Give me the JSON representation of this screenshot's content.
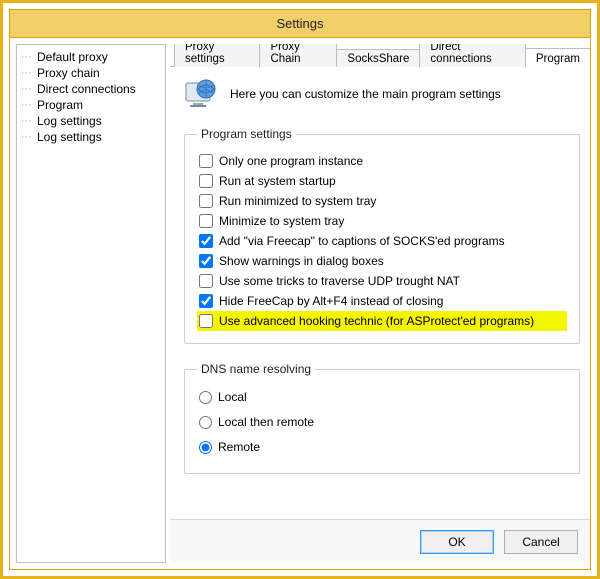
{
  "window": {
    "title": "Settings"
  },
  "tree": {
    "items": [
      {
        "label": "Default proxy"
      },
      {
        "label": "Proxy chain"
      },
      {
        "label": "Direct connections"
      },
      {
        "label": "Program"
      },
      {
        "label": "Log settings"
      },
      {
        "label": "Log settings"
      }
    ]
  },
  "tabs": [
    {
      "label": "Proxy settings"
    },
    {
      "label": "Proxy Chain"
    },
    {
      "label": "SocksShare"
    },
    {
      "label": "Direct connections"
    },
    {
      "label": "Program"
    }
  ],
  "intro": {
    "text": "Here you can customize the main program settings"
  },
  "program_group": {
    "legend": "Program settings",
    "options": [
      {
        "label": "Only one program instance",
        "checked": false
      },
      {
        "label": "Run at system startup",
        "checked": false
      },
      {
        "label": "Run minimized to system tray",
        "checked": false
      },
      {
        "label": "Minimize to system tray",
        "checked": false
      },
      {
        "label": "Add \"via Freecap\" to captions of SOCKS'ed programs",
        "checked": true
      },
      {
        "label": "Show warnings in dialog boxes",
        "checked": true
      },
      {
        "label": "Use some tricks to traverse UDP trought NAT",
        "checked": false
      },
      {
        "label": "Hide FreeCap by Alt+F4 instead of closing",
        "checked": true
      },
      {
        "label": "Use advanced hooking technic (for ASProtect'ed programs)",
        "checked": false,
        "highlight": true
      }
    ]
  },
  "dns_group": {
    "legend": "DNS name resolving",
    "options": [
      {
        "label": "Local",
        "selected": false
      },
      {
        "label": "Local then remote",
        "selected": false
      },
      {
        "label": "Remote",
        "selected": true
      }
    ]
  },
  "buttons": {
    "ok": "OK",
    "cancel": "Cancel"
  }
}
